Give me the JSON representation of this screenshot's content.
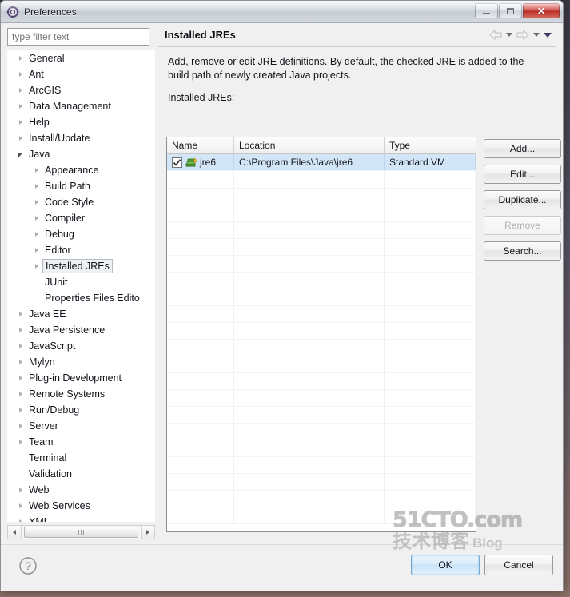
{
  "window": {
    "title": "Preferences",
    "icon": "preferences-gear-icon",
    "buttons": {
      "minimize": "minimize-icon",
      "maximize": "restore-icon",
      "close": "close-icon"
    }
  },
  "sidebar": {
    "filter": {
      "placeholder": "type filter text",
      "value": ""
    },
    "items": [
      {
        "label": "General",
        "level": 0,
        "state": "collapsed"
      },
      {
        "label": "Ant",
        "level": 0,
        "state": "collapsed"
      },
      {
        "label": "ArcGIS",
        "level": 0,
        "state": "collapsed"
      },
      {
        "label": "Data Management",
        "level": 0,
        "state": "collapsed"
      },
      {
        "label": "Help",
        "level": 0,
        "state": "collapsed"
      },
      {
        "label": "Install/Update",
        "level": 0,
        "state": "collapsed"
      },
      {
        "label": "Java",
        "level": 0,
        "state": "expanded"
      },
      {
        "label": "Appearance",
        "level": 1,
        "state": "collapsed"
      },
      {
        "label": "Build Path",
        "level": 1,
        "state": "collapsed"
      },
      {
        "label": "Code Style",
        "level": 1,
        "state": "collapsed"
      },
      {
        "label": "Compiler",
        "level": 1,
        "state": "collapsed"
      },
      {
        "label": "Debug",
        "level": 1,
        "state": "collapsed"
      },
      {
        "label": "Editor",
        "level": 1,
        "state": "collapsed"
      },
      {
        "label": "Installed JREs",
        "level": 1,
        "state": "collapsed",
        "selected": true
      },
      {
        "label": "JUnit",
        "level": 1,
        "state": "leaf"
      },
      {
        "label": "Properties Files Edito",
        "level": 1,
        "state": "leaf"
      },
      {
        "label": "Java EE",
        "level": 0,
        "state": "collapsed"
      },
      {
        "label": "Java Persistence",
        "level": 0,
        "state": "collapsed"
      },
      {
        "label": "JavaScript",
        "level": 0,
        "state": "collapsed"
      },
      {
        "label": "Mylyn",
        "level": 0,
        "state": "collapsed"
      },
      {
        "label": "Plug-in Development",
        "level": 0,
        "state": "collapsed"
      },
      {
        "label": "Remote Systems",
        "level": 0,
        "state": "collapsed"
      },
      {
        "label": "Run/Debug",
        "level": 0,
        "state": "collapsed"
      },
      {
        "label": "Server",
        "level": 0,
        "state": "collapsed"
      },
      {
        "label": "Team",
        "level": 0,
        "state": "collapsed"
      },
      {
        "label": "Terminal",
        "level": 0,
        "state": "leaf"
      },
      {
        "label": "Validation",
        "level": 0,
        "state": "leaf"
      },
      {
        "label": "Web",
        "level": 0,
        "state": "collapsed"
      },
      {
        "label": "Web Services",
        "level": 0,
        "state": "collapsed"
      },
      {
        "label": "XML",
        "level": 0,
        "state": "collapsed"
      }
    ]
  },
  "page": {
    "title": "Installed JREs",
    "description": "Add, remove or edit JRE definitions. By default, the checked JRE is added to the build path of newly created Java projects.",
    "list_label": "Installed JREs:",
    "nav": {
      "back": "back-arrow-icon",
      "back_menu": "back-dropdown-icon",
      "forward": "forward-arrow-icon",
      "forward_menu": "forward-dropdown-icon",
      "view_menu": "view-menu-icon"
    }
  },
  "table": {
    "columns": [
      "Name",
      "Location",
      "Type",
      ""
    ],
    "rows": [
      {
        "checked": true,
        "icon": "jre-library-icon",
        "name": "jre6",
        "location": "C:\\Program Files\\Java\\jre6",
        "type": "Standard VM",
        "selected": true
      }
    ],
    "empty_row_count": 21
  },
  "side_buttons": [
    {
      "label": "Add...",
      "enabled": true
    },
    {
      "label": "Edit...",
      "enabled": true
    },
    {
      "label": "Duplicate...",
      "enabled": true
    },
    {
      "label": "Remove",
      "enabled": false
    },
    {
      "label": "Search...",
      "enabled": true
    }
  ],
  "footer": {
    "help": "help-icon",
    "ok_label": "OK",
    "cancel_label": "Cancel"
  },
  "watermark": {
    "line1": "51CTO.com",
    "line2": "技术博客",
    "line3": "Blog"
  }
}
